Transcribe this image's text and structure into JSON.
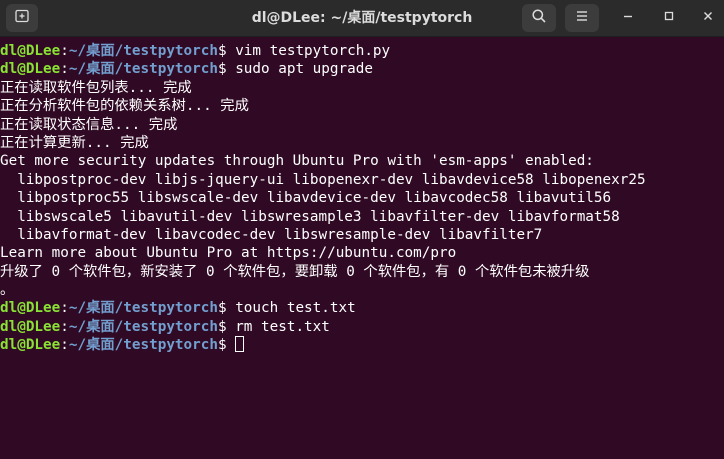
{
  "window": {
    "title": "dl@DLee: ~/桌面/testpytorch"
  },
  "titlebar": {
    "new_tab_icon": "new-tab-icon",
    "search_icon": "search-icon",
    "menu_icon": "hamburger-menu-icon",
    "minimize_icon": "minimize-icon",
    "maximize_icon": "maximize-icon",
    "close_icon": "close-icon"
  },
  "colors": {
    "background": "#300a24",
    "titlebar": "#2b2b2b",
    "prompt_user": "#8ae234",
    "prompt_path": "#729fcf",
    "text": "#ffffff"
  },
  "prompt": {
    "user_host": "dl@DLee",
    "colon": ":",
    "path": "~/桌面/testpytorch",
    "symbol": "$"
  },
  "terminal": {
    "commands": [
      " vim testpytorch.py",
      " sudo apt upgrade",
      " touch test.txt",
      " rm test.txt",
      " "
    ],
    "output_1": [
      "正在读取软件包列表... 完成",
      "正在分析软件包的依赖关系树... 完成",
      "正在读取状态信息... 完成",
      "正在计算更新... 完成",
      "Get more security updates through Ubuntu Pro with 'esm-apps' enabled:",
      "  libpostproc-dev libjs-jquery-ui libopenexr-dev libavdevice58 libopenexr25",
      "  libpostproc55 libswscale-dev libavdevice-dev libavcodec58 libavutil56",
      "  libswscale5 libavutil-dev libswresample3 libavfilter-dev libavformat58",
      "  libavformat-dev libavcodec-dev libswresample-dev libavfilter7",
      "Learn more about Ubuntu Pro at https://ubuntu.com/pro",
      "升级了 0 个软件包，新安装了 0 个软件包，要卸载 0 个软件包，有 0 个软件包未被升级",
      "。"
    ]
  }
}
